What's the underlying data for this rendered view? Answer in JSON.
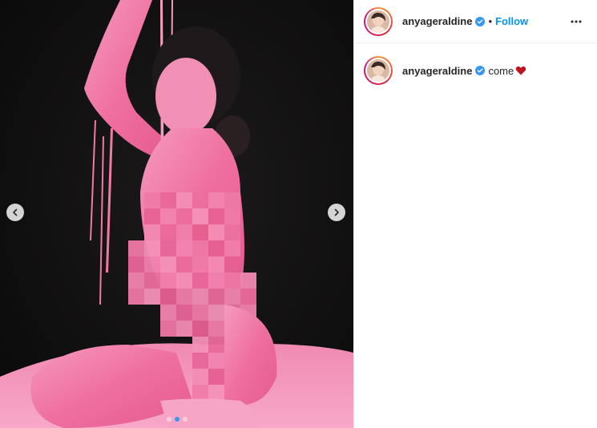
{
  "post": {
    "media": {
      "image_icon": "photo",
      "carousel": {
        "slide_count": 3,
        "active_index": 1
      },
      "nav": {
        "prev_icon": "chevron-left-icon",
        "next_icon": "chevron-right-icon"
      }
    },
    "header": {
      "username": "anyageraldine",
      "verified_icon": "verified-badge-icon",
      "separator": "•",
      "follow_label": "Follow",
      "more_icon": "more-options-icon"
    },
    "caption": {
      "username": "anyageraldine",
      "text": "come",
      "emoji_icon": "heart-icon"
    }
  },
  "colors": {
    "accent": "#0095f6",
    "verified": "#3897f0",
    "heart": "#c0131f",
    "background_dark": "#141213",
    "paint_pink": "#f27aa8"
  }
}
